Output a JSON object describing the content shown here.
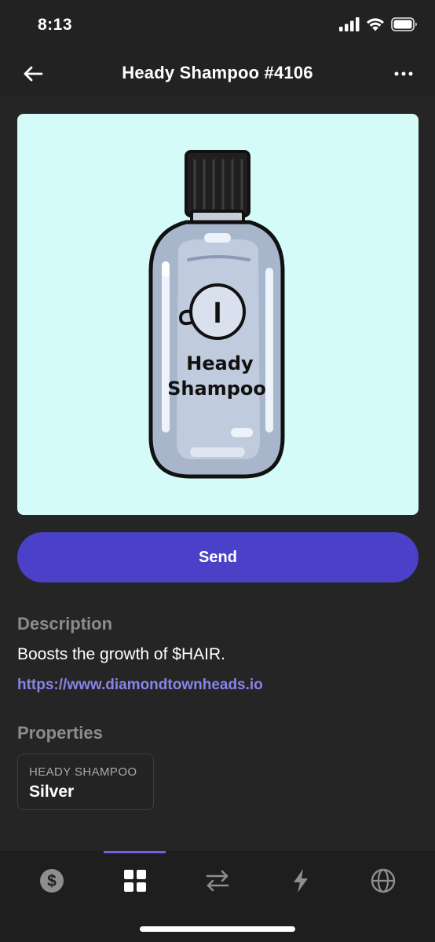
{
  "status_bar": {
    "time": "8:13"
  },
  "nav": {
    "title": "Heady Shampoo #4106"
  },
  "nft": {
    "label_line1": "Heady",
    "label_line2": "Shampoo",
    "emblem_text": "I",
    "background_color": "#d4fbf8"
  },
  "actions": {
    "send_label": "Send"
  },
  "description": {
    "title": "Description",
    "text": "Boosts the growth of $HAIR.",
    "link": "https://www.diamondtownheads.io"
  },
  "properties": {
    "title": "Properties",
    "items": [
      {
        "trait_type": "HEADY SHAMPOO",
        "value": "Silver"
      }
    ]
  },
  "tab_bar": {
    "selected": "collectibles",
    "tabs": [
      {
        "name": "wallet",
        "icon": "dollar-coin-icon"
      },
      {
        "name": "collectibles",
        "icon": "grid-icon"
      },
      {
        "name": "swap",
        "icon": "swap-arrows-icon"
      },
      {
        "name": "activity",
        "icon": "lightning-icon"
      },
      {
        "name": "browser",
        "icon": "globe-icon"
      }
    ]
  },
  "colors": {
    "background": "#252525",
    "accent": "#4a41c8",
    "link": "#8a83e8",
    "muted": "#8c8c8c"
  }
}
